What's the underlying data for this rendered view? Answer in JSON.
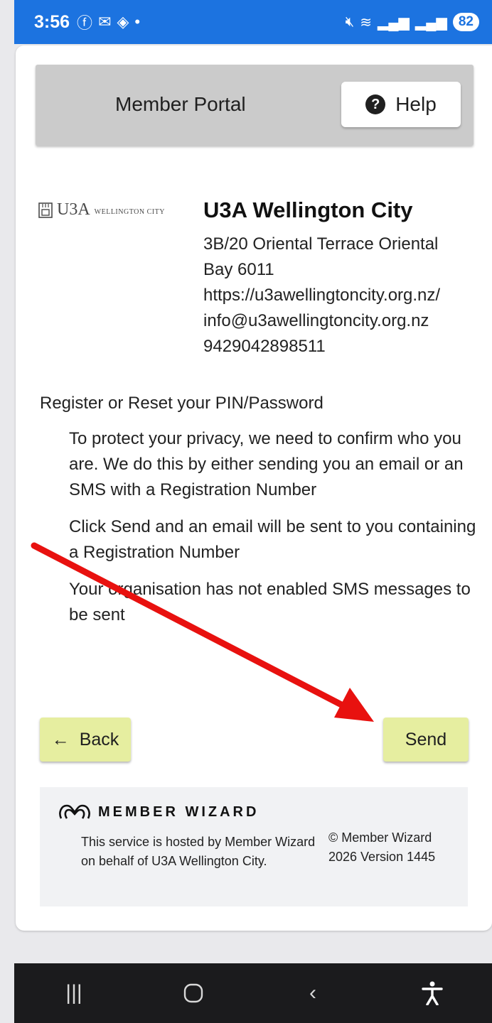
{
  "status_bar": {
    "time": "3:56",
    "icons": [
      "facebook-icon",
      "gmail-icon",
      "app-icon",
      "dot-icon"
    ],
    "right_icons": [
      "mute-icon",
      "wifi-icon",
      "signal-icon",
      "signal-icon"
    ],
    "battery": "82"
  },
  "header": {
    "title": "Member Portal",
    "help_label": "Help"
  },
  "org": {
    "logo_text": "U3A",
    "logo_sub": "WELLINGTON CITY",
    "name": "U3A Wellington City",
    "address_line1": "3B/20 Oriental Terrace Oriental",
    "address_line2": "Bay 6011",
    "website": "https://u3awellingtoncity.org.nz/",
    "email": "info@u3awellingtoncity.org.nz",
    "phone": "9429042898511"
  },
  "registration": {
    "title": "Register or Reset your PIN/Password",
    "paragraph1": "To protect your privacy, we need to confirm who you are. We do this by either sending you an email or an SMS with a Registration Number",
    "paragraph2": "Click Send and an email will be sent to you containing a Registration Number",
    "paragraph3": "Your organisation has not enabled SMS messages to be sent"
  },
  "actions": {
    "back_label": "Back",
    "send_label": "Send"
  },
  "footer": {
    "brand": "MEMBER WIZARD",
    "hosted_note": "This service is hosted by Member Wizard on behalf of U3A Wellington City.",
    "copyright": "© Member Wizard 2026 Version 1445"
  },
  "colors": {
    "status_bar": "#1c73e0",
    "button_bg": "#e6eea0",
    "arrow": "#e8110f"
  }
}
